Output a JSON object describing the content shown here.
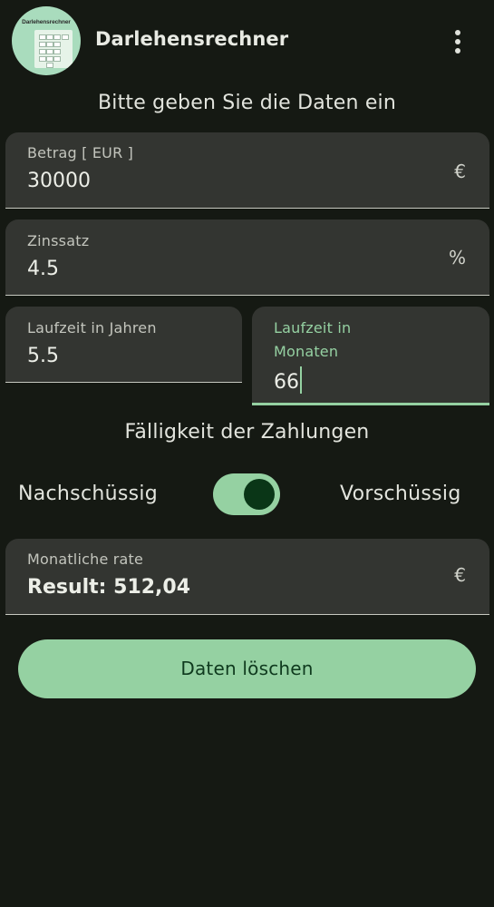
{
  "app": {
    "title": "Darlehensrechner",
    "logo_text": "Darlehensrechner",
    "menu_icon": "more-vertical-icon"
  },
  "form": {
    "heading": "Bitte geben Sie die Daten ein",
    "amount": {
      "label": "Betrag [ EUR ]",
      "value": "30000",
      "suffix": "€"
    },
    "interest": {
      "label": "Zinssatz",
      "value": "4.5",
      "suffix": "%"
    },
    "years": {
      "label": "Laufzeit in Jahren",
      "value": "5.5"
    },
    "months": {
      "label_line1": "Laufzeit in",
      "label_line2": "Monaten",
      "value": "66",
      "focused": true
    }
  },
  "payment_timing": {
    "heading": "Fälligkeit der Zahlungen",
    "left_label": "Nachschüssig",
    "right_label": "Vorschüssig",
    "switch_on": true
  },
  "result": {
    "label": "Monatliche rate",
    "value": "Result: 512,04",
    "suffix": "€"
  },
  "actions": {
    "clear_label": "Daten löschen"
  },
  "colors": {
    "background": "#151913",
    "field": "#333531",
    "accent": "#95d1a2",
    "on_accent": "#0f3a1e",
    "switch_thumb": "#0a3617"
  }
}
